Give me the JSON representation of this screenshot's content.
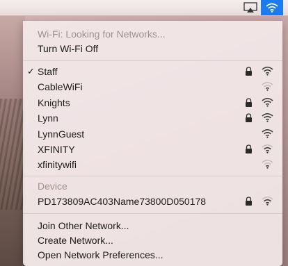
{
  "menubar": {
    "airplay_icon": "airplay-icon",
    "wifi_icon": "wifi-icon",
    "wifi_highlight_color": "#1b7cf0"
  },
  "status": {
    "text": "Wi-Fi: Looking for Networks...",
    "toggle_label": "Turn Wi-Fi Off"
  },
  "networks": [
    {
      "name": "Staff",
      "checked": true,
      "locked": true,
      "signal": 3
    },
    {
      "name": "CableWiFi",
      "checked": false,
      "locked": false,
      "signal": 1
    },
    {
      "name": "Knights",
      "checked": false,
      "locked": true,
      "signal": 3
    },
    {
      "name": "Lynn",
      "checked": false,
      "locked": true,
      "signal": 3
    },
    {
      "name": "LynnGuest",
      "checked": false,
      "locked": false,
      "signal": 3
    },
    {
      "name": "XFINITY",
      "checked": false,
      "locked": true,
      "signal": 2
    },
    {
      "name": "xfinitywifi",
      "checked": false,
      "locked": false,
      "signal": 1
    }
  ],
  "device": {
    "header": "Device",
    "name": "PD173809AC403Name73800D050178",
    "locked": true,
    "signal": 2
  },
  "actions": {
    "join_other": "Join Other Network...",
    "create": "Create Network...",
    "preferences": "Open Network Preferences..."
  },
  "check_mark": "✓"
}
